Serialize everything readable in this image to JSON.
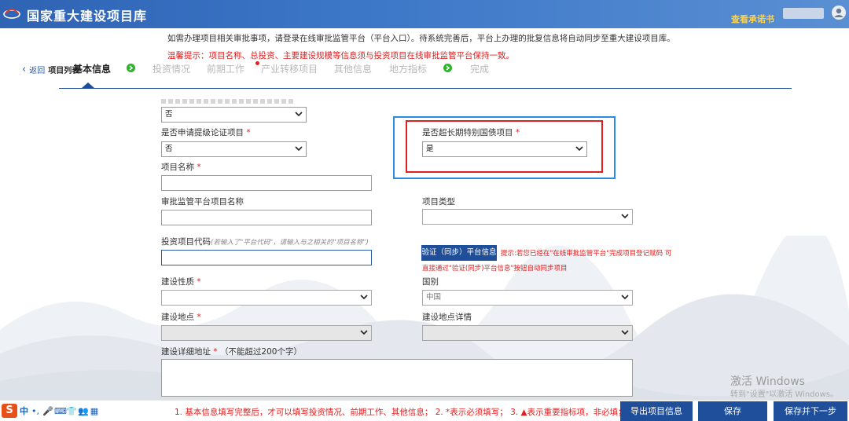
{
  "header": {
    "app_title": "国家重大建设项目库",
    "commitment_link": "查看承诺书"
  },
  "notices": {
    "info": "如需办理项目相关审批事项，请登录在线审批监管平台（平台入口）。待系统完善后，平台上办理的批复信息将自动同步至重大建设项目库。",
    "warning": "温馨提示：项目名称、总投资、主要建设规模等信息须与投资项目在线审批监管平台保持一致。"
  },
  "nav": {
    "back_label": "返回",
    "list_label": "项目列表",
    "steps": [
      "基本信息",
      "投资情况",
      "前期工作",
      "产业转移项目",
      "其他信息",
      "地方指标",
      "完成"
    ]
  },
  "form": {
    "top_select_value": "否",
    "demonstration": {
      "label": "是否申请提级论证项目",
      "req": "*",
      "value": "否"
    },
    "ultra_long_bond": {
      "label": "是否超长期特别国债项目",
      "req": "*",
      "value": "是"
    },
    "project_name": {
      "label": "项目名称",
      "req": "*"
    },
    "platform_project_name": {
      "label": "审批监管平台项目名称"
    },
    "project_type": {
      "label": "项目类型"
    },
    "investment_code": {
      "label": "投资项目代码",
      "hint": "(若输入了\"平台代码\"，请输入与之相关的\"项目名称\")"
    },
    "verify": {
      "button": "验证（同步）平台信息",
      "tip_line1": "提示:若您已经在\"在线审批监管平台\"完成项目登记赋码 可",
      "tip_line2": "直接通过\"验证(同步)平台信息\"按钮自动同步项目"
    },
    "construction_nature": {
      "label": "建设性质",
      "req": "*"
    },
    "country": {
      "label": "国别",
      "value": "中国"
    },
    "location": {
      "label": "建设地点",
      "req": "*"
    },
    "location_detail": {
      "label": "建设地点详情"
    },
    "address": {
      "label": "建设详细地址",
      "req": "*",
      "hint": "（不能超过200个字）"
    }
  },
  "watermark": {
    "title": "激活 Windows",
    "subtitle": "转到\"设置\"以激活 Windows。"
  },
  "footer": {
    "tip": "1. 基本信息填写完整后，才可以填写投资情况、前期工作、其他信息；  2. *表示必须填写；  3. ▲表示重要指标项，非必填；",
    "export_button": "导出项目信息",
    "save_button": "保存",
    "save_next_button": "保存并下一步",
    "ime_zh": "中",
    "ime_glyphs": [
      "•,",
      "🎤",
      "⌨",
      "👕",
      "👥",
      "▦"
    ]
  },
  "colors": {
    "header_blue": "#2f63b4",
    "button_blue": "#1f4f9a",
    "required_red": "#e02020",
    "highlight_blue": "#2b8ae6",
    "step_done_green": "#2bb52b",
    "commit_yellow": "#ffd24a"
  }
}
